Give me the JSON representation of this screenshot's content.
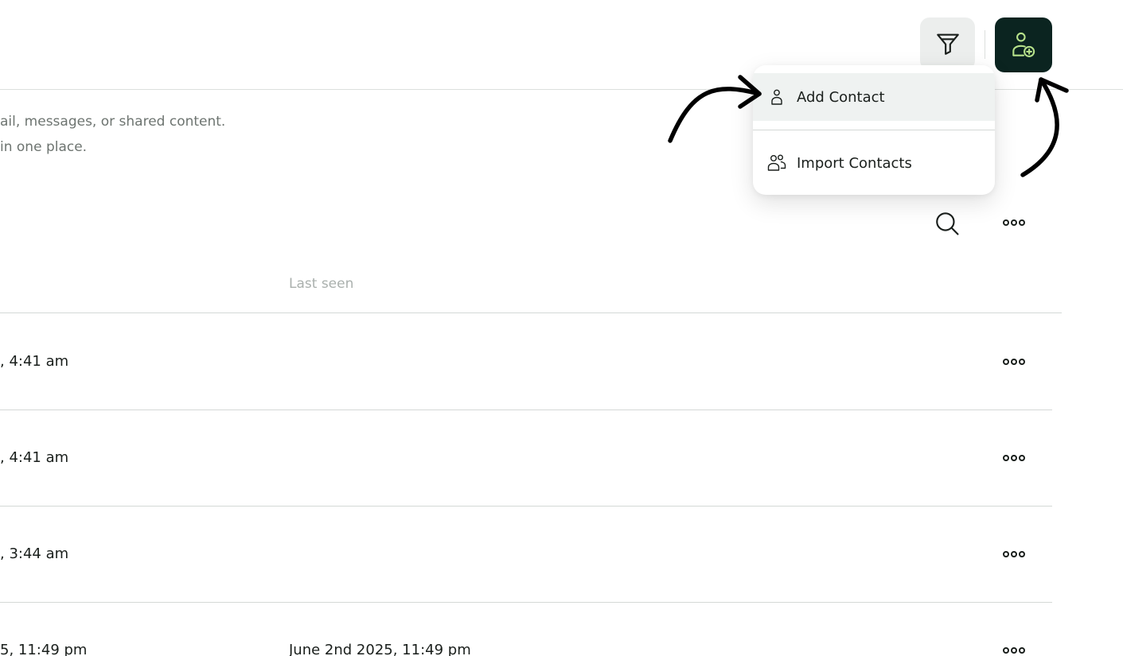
{
  "header": {
    "filter_icon": "filter-funnel-icon",
    "add_icon": "add-contact-icon",
    "accent_dark": "#0b2420",
    "accent_green": "#b7e28b"
  },
  "description": {
    "line1": "ail, messages, or shared content.",
    "line2": "in one place."
  },
  "toolbar": {
    "search_icon": "search-icon",
    "more_icon": "more-horizontal-icon"
  },
  "table": {
    "headers": {
      "last_seen": "Last seen"
    },
    "rows": [
      {
        "col1": ", 4:41 am",
        "last_seen": ""
      },
      {
        "col1": ", 4:41 am",
        "last_seen": ""
      },
      {
        "col1": ", 3:44 am",
        "last_seen": ""
      },
      {
        "col1": "5, 11:49 pm",
        "last_seen": "June 2nd 2025, 11:49 pm"
      }
    ]
  },
  "menu": {
    "items": [
      {
        "label": "Add Contact",
        "icon": "user-icon"
      },
      {
        "label": "Import Contacts",
        "icon": "users-icon"
      }
    ]
  }
}
